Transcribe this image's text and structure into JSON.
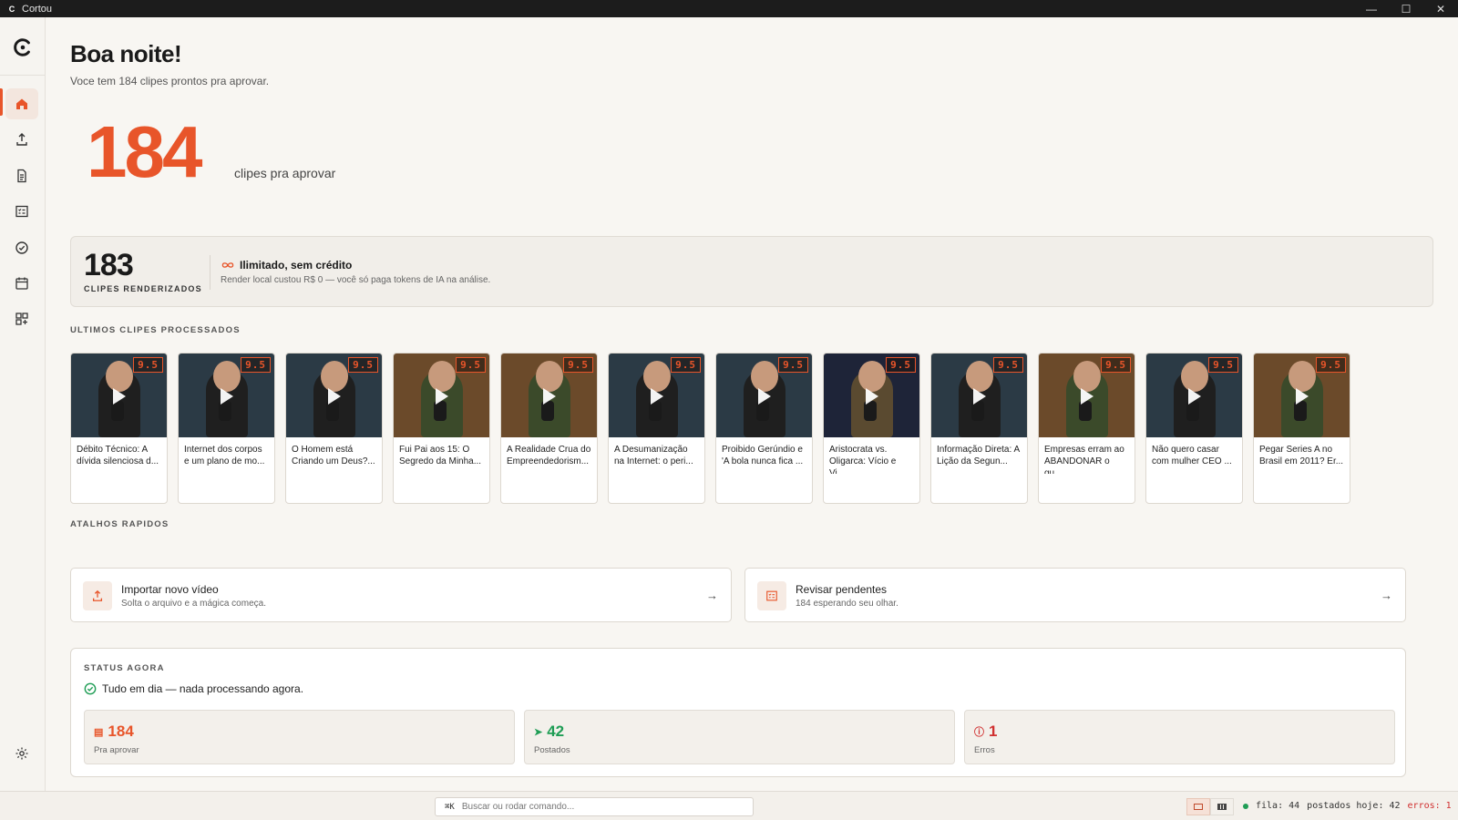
{
  "window": {
    "title": "Cortou",
    "logo_letter": "C"
  },
  "greeting": {
    "title": "Boa noite!",
    "subtitle": "Voce tem 184 clipes prontos pra aprovar."
  },
  "hero": {
    "count": "184",
    "label": "clipes pra aprovar"
  },
  "render": {
    "count": "183",
    "label": "CLIPES RENDERIZADOS",
    "title": "Ilimitado, sem crédito",
    "desc": "Render local custou R$ 0 — você só paga tokens de IA na análise."
  },
  "recent": {
    "label": "ULTIMOS CLIPES PROCESSADOS",
    "clips": [
      {
        "title": "Débito Técnico: A dívida silenciosa d...",
        "score": "9.5",
        "bg": "#2b3a45",
        "shirt": "#1f1f1f"
      },
      {
        "title": "Internet dos corpos e um plano de mo...",
        "score": "9.5",
        "bg": "#2b3a45",
        "shirt": "#1f1f1f"
      },
      {
        "title": "O Homem está Criando um Deus?...",
        "score": "9.5",
        "bg": "#2b3a45",
        "shirt": "#1f1f1f"
      },
      {
        "title": "Fui Pai aos 15: O Segredo da Minha...",
        "score": "9.5",
        "bg": "#6b4a2a",
        "shirt": "#3b4a2a"
      },
      {
        "title": "A Realidade Crua do Empreendedorism...",
        "score": "9.5",
        "bg": "#6b4a2a",
        "shirt": "#3b4a2a"
      },
      {
        "title": "A Desumanização na Internet: o peri...",
        "score": "9.5",
        "bg": "#2b3a45",
        "shirt": "#1f1f1f"
      },
      {
        "title": "Proibido Gerúndio e 'A bola nunca fica ...",
        "score": "9.5",
        "bg": "#2b3a45",
        "shirt": "#1f1f1f"
      },
      {
        "title": "Aristocrata vs. Oligarca: Vício e Vi...",
        "score": "9.5",
        "bg": "#1e2438",
        "shirt": "#5a4a30"
      },
      {
        "title": "Informação Direta: A Lição da Segun...",
        "score": "9.5",
        "bg": "#2b3a45",
        "shirt": "#1f1f1f"
      },
      {
        "title": "Empresas erram ao ABANDONAR o qu...",
        "score": "9.5",
        "bg": "#6b4a2a",
        "shirt": "#3b4a2a"
      },
      {
        "title": "Não quero casar com mulher CEO ...",
        "score": "9.5",
        "bg": "#2b3a45",
        "shirt": "#1f1f1f"
      },
      {
        "title": "Pegar Series A no Brasil em 2011? Er...",
        "score": "9.5",
        "bg": "#6b4a2a",
        "shirt": "#3b4a2a"
      }
    ]
  },
  "shortcuts": {
    "label": "ATALHOS RAPIDOS",
    "import": {
      "title": "Importar novo vídeo",
      "desc": "Solta o arquivo e a mágica começa."
    },
    "review": {
      "title": "Revisar pendentes",
      "desc": "184 esperando seu olhar."
    }
  },
  "status": {
    "label": "STATUS AGORA",
    "message": "Tudo em dia — nada processando agora.",
    "pending": {
      "value": "184",
      "label": "Pra aprovar"
    },
    "posted": {
      "value": "42",
      "label": "Postados"
    },
    "errors": {
      "value": "1",
      "label": "Erros"
    }
  },
  "statusbar": {
    "shortcut": "⌘K",
    "placeholder": "Buscar ou rodar comando...",
    "queue": "fila: 44",
    "posted_today": "postados hoje: 42",
    "errors": "erros: 1"
  },
  "colors": {
    "accent": "#e8552a",
    "success": "#1f9d55",
    "error": "#d03030"
  }
}
